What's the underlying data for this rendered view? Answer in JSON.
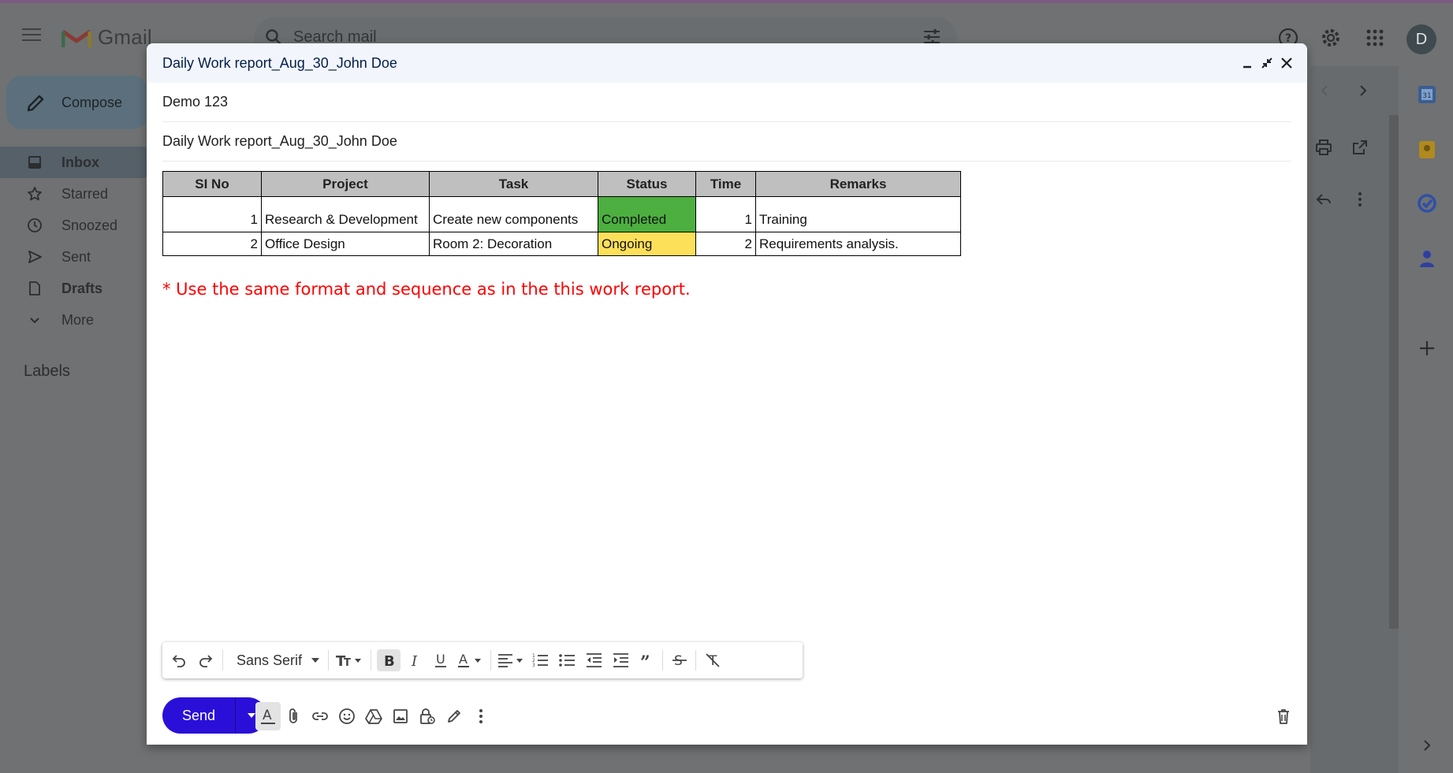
{
  "app": {
    "name": "Gmail"
  },
  "search": {
    "placeholder": "Search mail"
  },
  "avatar": {
    "initial": "D"
  },
  "sidebar": {
    "compose_label": "Compose",
    "items": [
      {
        "label": "Inbox",
        "icon": "inbox-icon"
      },
      {
        "label": "Starred",
        "icon": "star-icon"
      },
      {
        "label": "Snoozed",
        "icon": "clock-icon"
      },
      {
        "label": "Sent",
        "icon": "send-icon"
      },
      {
        "label": "Drafts",
        "icon": "draft-icon"
      },
      {
        "label": "More",
        "icon": "chevron-down-icon"
      }
    ],
    "labels_heading": "Labels"
  },
  "compose": {
    "title": "Daily Work report_Aug_30_John Doe",
    "to": "Demo 123",
    "subject": "Daily Work report_Aug_30_John Doe",
    "table": {
      "headers": [
        "SI No",
        "Project",
        "Task",
        "Status",
        "Time",
        "Remarks"
      ],
      "rows": [
        [
          "1",
          "Research & Development",
          "Create new components",
          "Completed",
          "1",
          "Training"
        ],
        [
          "2",
          "Office Design",
          "Room 2: Decoration",
          "Ongoing",
          "2",
          "Requirements analysis."
        ]
      ]
    },
    "note": "* Use the same format and sequence as in the this work report.",
    "status_colors": {
      "Completed": "#4caf3f",
      "Ongoing": "#fde05a"
    }
  },
  "toolbar": {
    "font": "Sans Serif"
  },
  "footer": {
    "send_label": "Send"
  },
  "colors": {
    "send": "#2a0fd8",
    "note": "#ff0000",
    "header_bg": "#bfbfbf"
  }
}
